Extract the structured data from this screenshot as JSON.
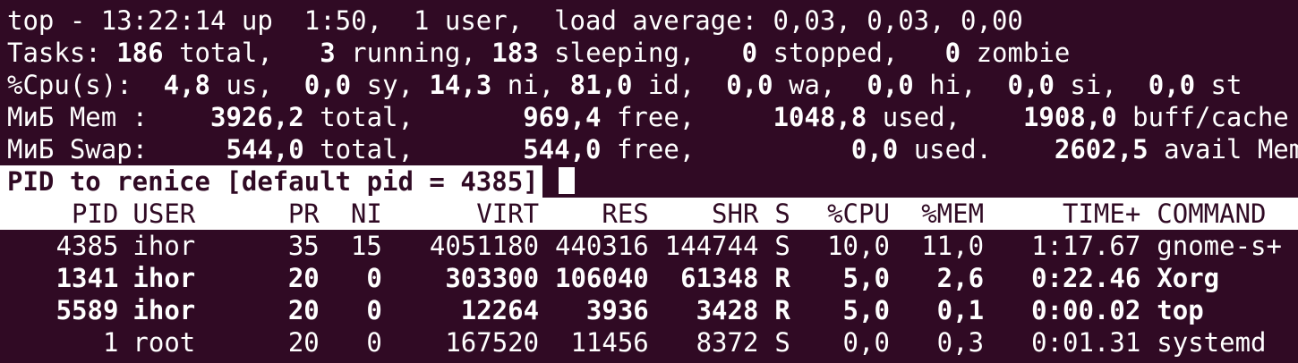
{
  "summary": {
    "line1": "top - 13:22:14 up  1:50,  1 user,  load average: 0,03, 0,03, 0,00",
    "tasks": {
      "label": "Tasks: ",
      "total": "186",
      "total_suffix": " total,   ",
      "running": "3",
      "running_suffix": " running, ",
      "sleeping": "183",
      "sleeping_suffix": " sleeping,   ",
      "stopped": "0",
      "stopped_suffix": " stopped,   ",
      "zombie": "0",
      "zombie_suffix": " zombie"
    },
    "cpu": {
      "label": "%Cpu(s):  ",
      "us": "4,8",
      "us_suffix": " us,  ",
      "sy": "0,0",
      "sy_suffix": " sy, ",
      "ni": "14,3",
      "ni_suffix": " ni, ",
      "id": "81,0",
      "id_suffix": " id,  ",
      "wa": "0,0",
      "wa_suffix": " wa,  ",
      "hi": "0,0",
      "hi_suffix": " hi,  ",
      "si": "0,0",
      "si_suffix": " si,  ",
      "st": "0,0",
      "st_suffix": " st"
    },
    "mem": {
      "label": "МиБ Mem :    ",
      "total": "3926,2",
      "total_suffix": " total,       ",
      "free": "969,4",
      "free_suffix": " free,     ",
      "used": "1048,8",
      "used_suffix": " used,    ",
      "buff": "1908,0",
      "buff_suffix": " buff/cache"
    },
    "swap": {
      "label": "МиБ Swap:     ",
      "total": "544,0",
      "total_suffix": " total,       ",
      "free": "544,0",
      "free_suffix": " free,          ",
      "used": "0,0",
      "used_suffix": " used.    ",
      "avail": "2602,5",
      "avail_suffix": " avail Mem"
    }
  },
  "prompt": "PID to renice [default pid = 4385]",
  "columns": {
    "pid": "PID",
    "user": "USER",
    "pr": "PR",
    "ni": "NI",
    "virt": "VIRT",
    "res": "RES",
    "shr": "SHR",
    "s": "S",
    "cpu": "%CPU",
    "mem": "%MEM",
    "time": "TIME+",
    "command": "COMMAND"
  },
  "processes": [
    {
      "pid": "4385",
      "user": "ihor",
      "pr": "35",
      "ni": "15",
      "virt": "4051180",
      "res": "440316",
      "shr": "144744",
      "s": "S",
      "cpu": "10,0",
      "mem": "11,0",
      "time": "1:17.67",
      "command": "gnome-s+",
      "bold": false
    },
    {
      "pid": "1341",
      "user": "ihor",
      "pr": "20",
      "ni": "0",
      "virt": "303300",
      "res": "106040",
      "shr": "61348",
      "s": "R",
      "cpu": "5,0",
      "mem": "2,6",
      "time": "0:22.46",
      "command": "Xorg",
      "bold": true
    },
    {
      "pid": "5589",
      "user": "ihor",
      "pr": "20",
      "ni": "0",
      "virt": "12264",
      "res": "3936",
      "shr": "3428",
      "s": "R",
      "cpu": "5,0",
      "mem": "0,1",
      "time": "0:00.02",
      "command": "top",
      "bold": true
    },
    {
      "pid": "1",
      "user": "root",
      "pr": "20",
      "ni": "0",
      "virt": "167520",
      "res": "11456",
      "shr": "8372",
      "s": "S",
      "cpu": "0,0",
      "mem": "0,3",
      "time": "0:01.31",
      "command": "systemd",
      "bold": false
    }
  ],
  "colors": {
    "background": "#300a24",
    "foreground": "#ffffff"
  }
}
